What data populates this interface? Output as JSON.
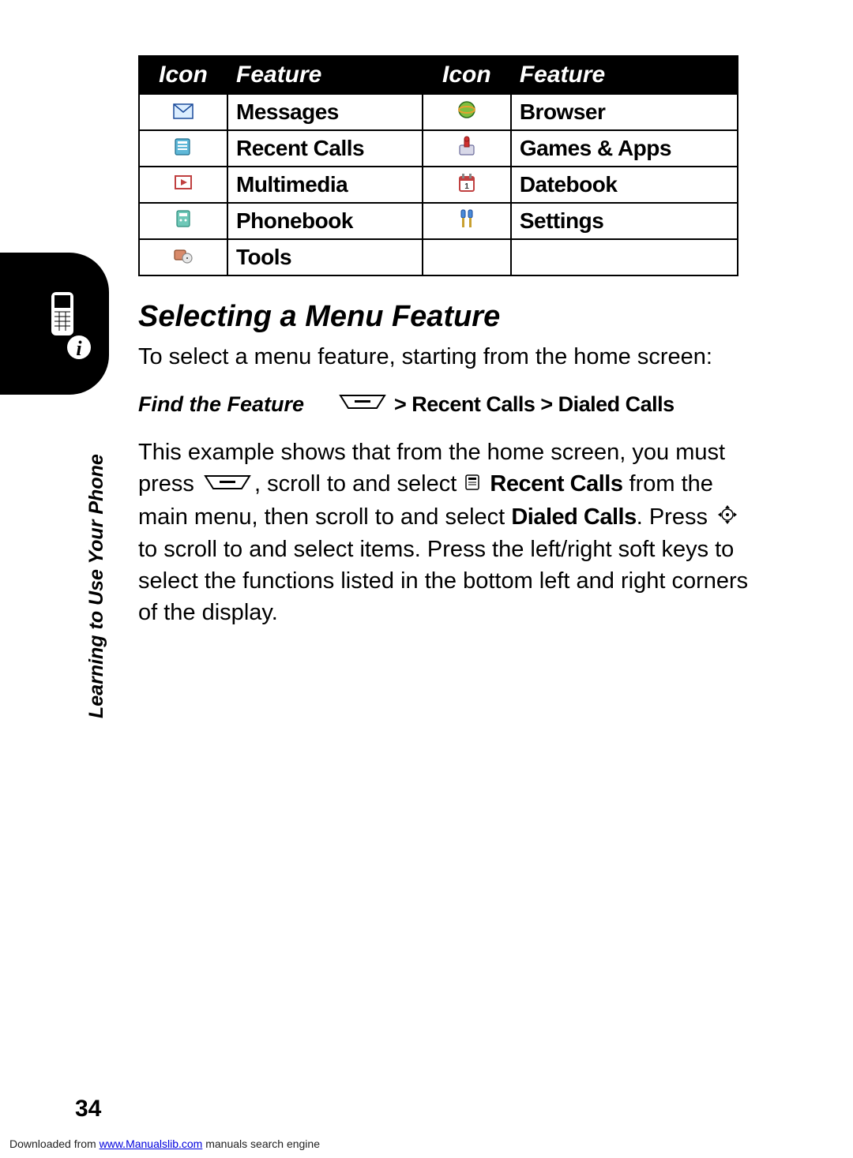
{
  "table": {
    "headers": [
      "Icon",
      "Feature",
      "Icon",
      "Feature"
    ],
    "rows": [
      {
        "left": "Messages",
        "right": "Browser"
      },
      {
        "left": "Recent Calls",
        "right": "Games & Apps"
      },
      {
        "left": "Multimedia",
        "right": "Datebook"
      },
      {
        "left": "Phonebook",
        "right": "Settings"
      },
      {
        "left": "Tools",
        "right": ""
      }
    ]
  },
  "section_heading": "Selecting a Menu Feature",
  "intro": "To select a menu feature, starting from the home screen:",
  "find_label": "Find the Feature",
  "find_path_1": "> Recent Calls > Dialed Calls",
  "body_part1": "This example shows that from the home screen, you must press ",
  "body_part2": ", scroll to and select ",
  "body_recent": "Recent Calls",
  "body_part3": " from the main menu, then scroll to and select ",
  "body_dialed": "Dialed Calls",
  "body_part4": ". Press ",
  "body_part5": " to scroll to and select items. Press the left/right soft keys to select the functions listed in the bottom left and right corners of the display.",
  "side_label": "Learning to Use Your Phone",
  "page_number": "34",
  "footer_prefix": "Downloaded from ",
  "footer_link": "www.Manualslib.com",
  "footer_suffix": " manuals search engine"
}
